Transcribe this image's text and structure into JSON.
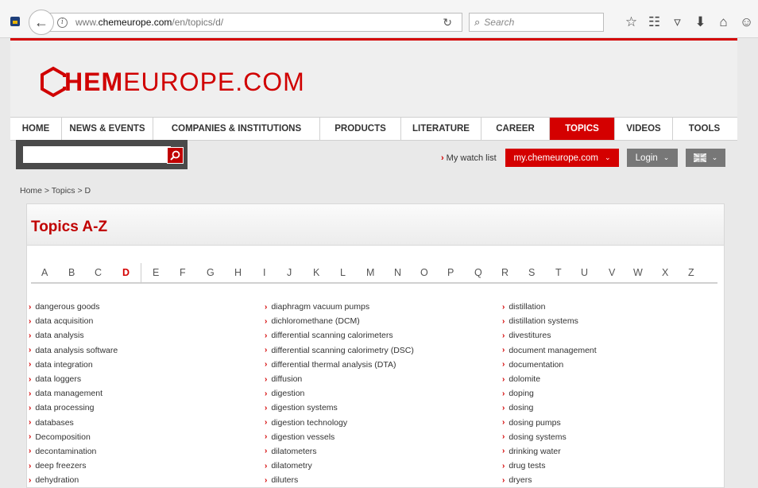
{
  "browser": {
    "url_plain_prefix": "www.",
    "url_domain": "chemeurope.com",
    "url_path": "/en/topics/d/",
    "search_placeholder": "Search"
  },
  "site": {
    "logo_bold": "HEM",
    "logo_light": "EUROPE.COM",
    "nav": [
      "HOME",
      "NEWS & EVENTS",
      "COMPANIES & INSTITUTIONS",
      "PRODUCTS",
      "LITERATURE",
      "CAREER",
      "TOPICS",
      "VIDEOS",
      "TOOLS"
    ],
    "active_nav": "TOPICS",
    "watch_list": "My watch list",
    "my_button": "my.chemeurope.com",
    "login_button": "Login",
    "breadcrumb": "Home > Topics > D"
  },
  "topics": {
    "title": "Topics A-Z",
    "letters": [
      "A",
      "B",
      "C",
      "D",
      "E",
      "F",
      "G",
      "H",
      "I",
      "J",
      "K",
      "L",
      "M",
      "N",
      "O",
      "P",
      "Q",
      "R",
      "S",
      "T",
      "U",
      "V",
      "W",
      "X",
      "Z"
    ],
    "active_letter": "D",
    "columns": [
      [
        "dangerous goods",
        "data acquisition",
        "data analysis",
        "data analysis software",
        "data integration",
        "data loggers",
        "data management",
        "data processing",
        "databases",
        "Decomposition",
        "decontamination",
        "deep freezers",
        "dehydration"
      ],
      [
        "diaphragm vacuum pumps",
        "dichloromethane (DCM)",
        "differential scanning calorimeters",
        "differential scanning calorimetry (DSC)",
        "differential thermal analysis (DTA)",
        "diffusion",
        "digestion",
        "digestion systems",
        "digestion technology",
        "digestion vessels",
        "dilatometers",
        "dilatometry",
        "diluters"
      ],
      [
        "distillation",
        "distillation systems",
        "divestitures",
        "document management",
        "documentation",
        "dolomite",
        "doping",
        "dosing",
        "dosing pumps",
        "dosing systems",
        "drinking water",
        "drug tests",
        "dryers"
      ]
    ]
  },
  "colors": {
    "brand_red": "#d40000",
    "grey_button": "#777777",
    "search_panel": "#4a4a4a"
  }
}
